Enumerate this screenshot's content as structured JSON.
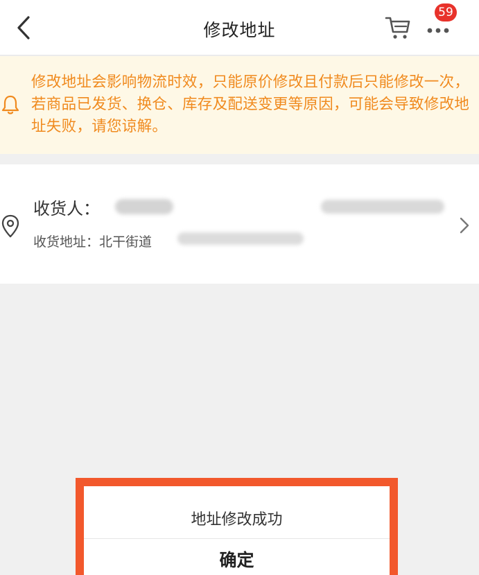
{
  "header": {
    "title": "修改地址",
    "badge_count": "59",
    "icons": {
      "back": "chevron-left-icon",
      "cart": "cart-icon",
      "more": "more-icon"
    }
  },
  "notice": {
    "icon": "bell-icon",
    "text": "修改地址会影响物流时效，只能原价修改且付款后只能修改一次，若商品已发货、换仓、库存及配送变更等原因，可能会导致修改地址失败，请您谅解。",
    "color": "#f08a1e"
  },
  "address": {
    "icon": "location-pin-icon",
    "receiver_label": "收货人：",
    "address_label": "收货地址：北干街道"
  },
  "dialog": {
    "message": "地址修改成功",
    "confirm_label": "确定",
    "highlight_color": "#f2582c"
  },
  "colors": {
    "badge": "#e8322b",
    "notice_bg": "#fef8e6",
    "page_bg": "#f0f0f0"
  }
}
